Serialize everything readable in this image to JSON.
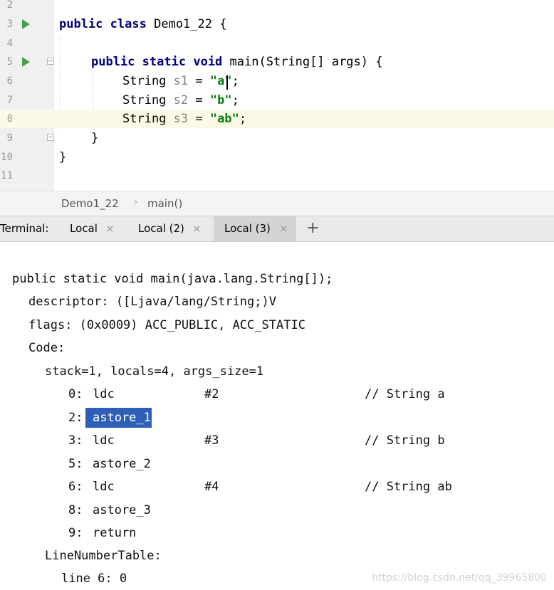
{
  "editor": {
    "line_numbers": [
      "2",
      "3",
      "4",
      "5",
      "6",
      "7",
      "8",
      "9",
      "10",
      "11"
    ],
    "class_line": {
      "kw1": "public",
      "kw2": "class",
      "name": "Demo1_22",
      "brace": "{"
    },
    "main_line": {
      "kw1": "public",
      "kw2": "static",
      "kw3": "void",
      "rest": "main(String[] args) {"
    },
    "s1": {
      "type": "String",
      "name": "s1",
      "eq": "=",
      "value": "\"a\"",
      "semi": ";"
    },
    "s2": {
      "type": "String",
      "name": "s2",
      "eq": "=",
      "value": "\"b\"",
      "semi": ";"
    },
    "s3": {
      "type": "String",
      "name": "s3",
      "eq": "=",
      "value": "\"ab\"",
      "semi": ";"
    },
    "close_method": "}",
    "close_class": "}"
  },
  "breadcrumb": {
    "class_name": "Demo1_22",
    "method": "main()",
    "separator": "›"
  },
  "terminal_bar": {
    "label": "Terminal:",
    "tabs": [
      {
        "label": "Local"
      },
      {
        "label": "Local (2)"
      },
      {
        "label": "Local (3)"
      }
    ],
    "close_glyph": "×",
    "add_glyph": "+"
  },
  "terminal": {
    "method_sig": "public static void main(java.lang.String[]);",
    "descriptor": "descriptor: ([Ljava/lang/String;)V",
    "flags": "flags: (0x0009) ACC_PUBLIC, ACC_STATIC",
    "code": "Code:",
    "stack": "stack=1, locals=4, args_size=1",
    "instructions": [
      {
        "off": "0:",
        "op": "ldc",
        "arg": "#2",
        "comment": "// String a"
      },
      {
        "off": "2:",
        "op": "astore_1",
        "arg": "",
        "comment": ""
      },
      {
        "off": "3:",
        "op": "ldc",
        "arg": "#3",
        "comment": "// String b"
      },
      {
        "off": "5:",
        "op": "astore_2",
        "arg": "",
        "comment": ""
      },
      {
        "off": "6:",
        "op": "ldc",
        "arg": "#4",
        "comment": "// String ab"
      },
      {
        "off": "8:",
        "op": "astore_3",
        "arg": "",
        "comment": ""
      },
      {
        "off": "9:",
        "op": "return",
        "arg": "",
        "comment": ""
      }
    ],
    "lnt": "LineNumberTable:",
    "lnt_line": "line 6: 0"
  },
  "watermark": "https://blog.csdn.net/qq_39965800",
  "colors": {
    "keyword": "#000080",
    "string": "#067d17",
    "selection": "#2e5fb8",
    "run_icon": "#49a04c",
    "highlight_line": "#fcfae6"
  }
}
